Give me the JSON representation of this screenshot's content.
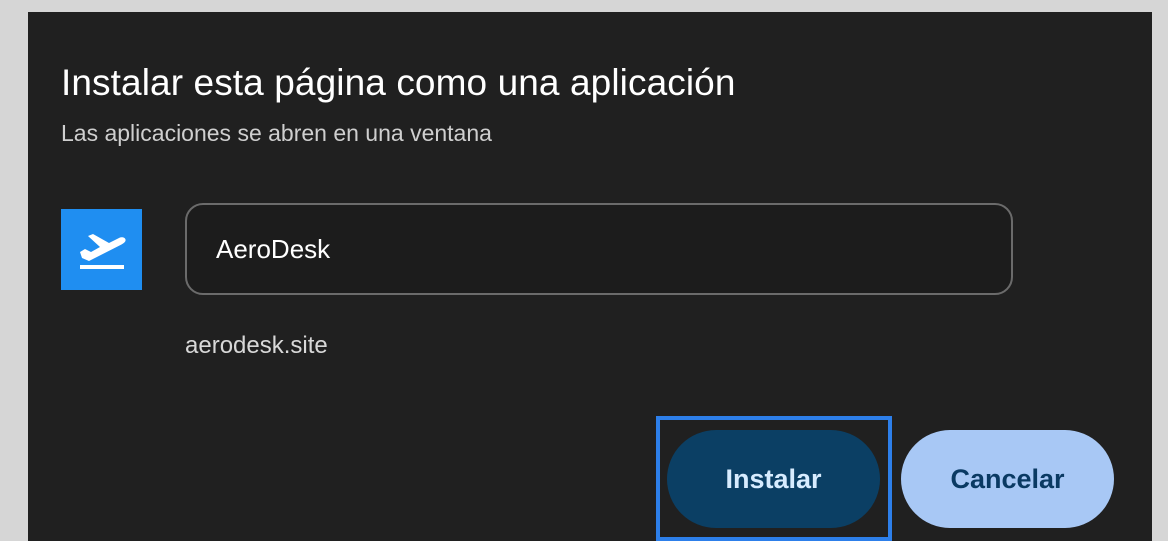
{
  "dialog": {
    "title": "Instalar esta página como una aplicación",
    "subtitle": "Las aplicaciones se abren en una ventana",
    "app_icon": "plane-takeoff-icon",
    "name_field_value": "AeroDesk",
    "domain": "aerodesk.site",
    "install_label": "Instalar",
    "cancel_label": "Cancelar"
  },
  "colors": {
    "dialog_bg": "#202020",
    "icon_bg": "#1f8ef1",
    "install_bg": "#0b3f64",
    "cancel_bg": "#a8c8f5",
    "focus_ring": "#2d7fea"
  }
}
